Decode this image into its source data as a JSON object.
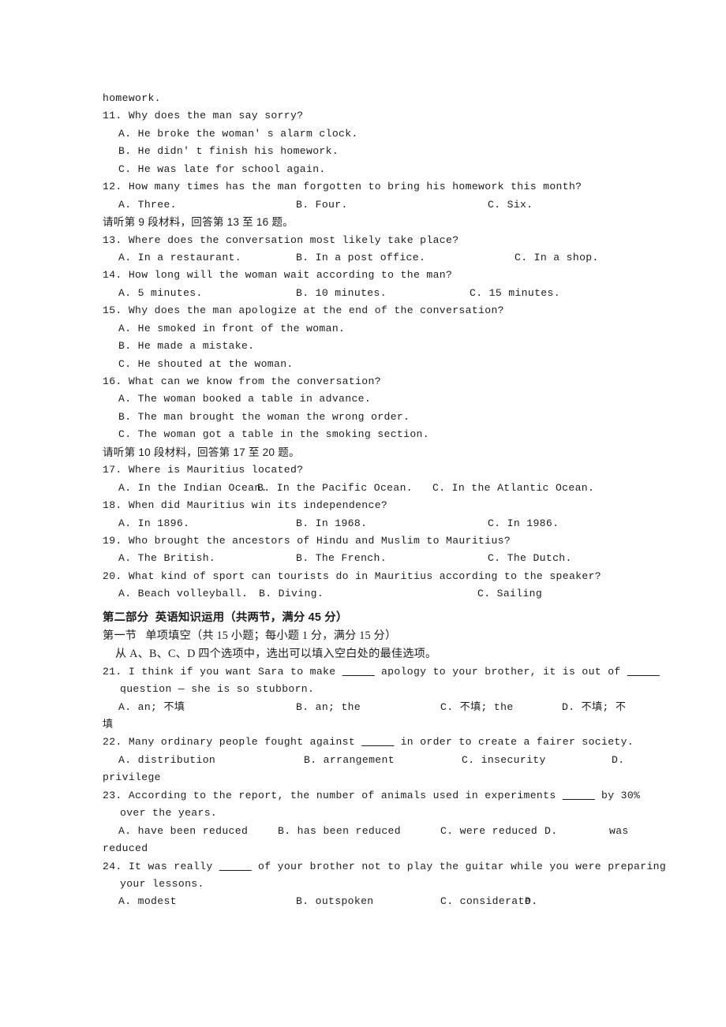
{
  "document": {
    "type": "english-exam-paper",
    "page_text_color": "#1c1c1c",
    "background_color": "#ffffff"
  },
  "carryover_line": "homework.",
  "listening": {
    "questions": [
      {
        "number": "11.",
        "stem": "11. Why does the man say sorry?",
        "options_stacked": [
          "A. He broke the woman' s alarm clock.",
          "B. He didn' t finish his homework.",
          "C. He was late for school again."
        ]
      },
      {
        "number": "12.",
        "stem": "12. How many times has the man forgotten to bring his homework this month?",
        "options_inline": [
          "A. Three.",
          "B. Four.",
          "C. Six."
        ]
      }
    ],
    "cue_9": "请听第 9 段材料，回答第 13 至 16 题。",
    "questions_9": [
      {
        "number": "13.",
        "stem": "13. Where does the conversation most likely take place?",
        "options_inline": [
          "A. In a restaurant.",
          "B. In a post office.",
          "C. In a shop."
        ]
      },
      {
        "number": "14.",
        "stem": "14. How long will the woman wait according to the man?",
        "options_inline": [
          "A. 5 minutes.",
          "B. 10 minutes.",
          "C. 15 minutes."
        ]
      },
      {
        "number": "15.",
        "stem": "15. Why does the man apologize at the end of the conversation?",
        "options_stacked": [
          "A. He smoked in front of the woman.",
          "B. He made a mistake.",
          "C. He shouted at the woman."
        ]
      },
      {
        "number": "16.",
        "stem": "16. What can we know from the conversation?",
        "options_stacked": [
          "A. The woman booked a table in advance.",
          "B. The man brought the woman the wrong order.",
          "C. The woman got a table in the smoking section."
        ]
      }
    ],
    "cue_10": "请听第 10 段材料，回答第 17 至 20 题。",
    "questions_10": [
      {
        "number": "17.",
        "stem": "17. Where is Mauritius located?",
        "options_inline": [
          "A. In the Indian Ocean.",
          "B. In the Pacific Ocean.",
          "C. In the Atlantic Ocean."
        ]
      },
      {
        "number": "18.",
        "stem": "18. When did Mauritius win its independence?",
        "options_inline": [
          "A. In 1896.",
          "B. In 1968.",
          "C. In 1986."
        ]
      },
      {
        "number": "19.",
        "stem": "19. Who brought the ancestors of Hindu and Muslim to Mauritius?",
        "options_inline": [
          "A. The British.",
          "B. The French.",
          "C. The Dutch."
        ]
      },
      {
        "number": "20.",
        "stem": "20. What kind of sport can tourists do in Mauritius according to the speaker?",
        "options_inline": [
          "A. Beach volleyball.",
          "B. Diving.",
          "C. Sailing"
        ]
      }
    ]
  },
  "part_two": {
    "heading": "第二部分  英语知识运用（共两节，满分 45 分）",
    "section_one": "第一节   单项填空（共 15 小题；每小题 1 分，满分 15 分）",
    "instruction": "从 A、B、C、D 四个选项中，选出可以填入空白处的最佳选项。",
    "questions": [
      {
        "number": "21.",
        "stem_line1_a": "21. I think if you want Sara to make ",
        "stem_blank1": "_____",
        "stem_line1_b": " apology to your brother, it is out of ",
        "stem_blank2": "_____",
        "stem_line2": "question — she is so stubborn.",
        "options_inline": [
          "A. an; 不填",
          "B. an; the",
          "C. 不填; the",
          "D. 不填; 不"
        ],
        "options_overflow": "填"
      },
      {
        "number": "22.",
        "stem_a": "22. Many ordinary people fought against ",
        "stem_blank": "_____",
        "stem_b": " in order to create a fairer society.",
        "options_inline": [
          "A. distribution",
          "B. arrangement",
          "C. insecurity",
          "D."
        ],
        "options_overflow": "privilege"
      },
      {
        "number": "23.",
        "stem_a": "23. According to the report, the number of animals used in experiments ",
        "stem_blank": "_____",
        "stem_b": " by 30%",
        "stem_line2": "over the years.",
        "options_inline": [
          "A. have been reduced",
          "B. has been reduced",
          "C. were reduced",
          "D.",
          "was"
        ],
        "options_overflow": "reduced"
      },
      {
        "number": "24.",
        "stem_a": "24. It was really ",
        "stem_blank": "_____",
        "stem_b": " of your brother not to play the guitar while you were preparing",
        "stem_line2": "your lessons.",
        "options_inline": [
          "A. modest",
          "B. outspoken",
          "C. considerate",
          "D."
        ]
      }
    ]
  }
}
